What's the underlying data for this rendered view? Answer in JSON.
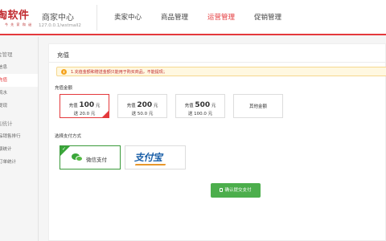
{
  "header": {
    "logo_text": "淘软件",
    "logo_tagline": "今 先 家 和 谜",
    "title": "商家中心",
    "url": "127.0.0.1/wstmall2",
    "nav": [
      {
        "label": "卖家中心",
        "active": false
      },
      {
        "label": "商品管理",
        "active": false
      },
      {
        "label": "运营管理",
        "active": true
      },
      {
        "label": "促销管理",
        "active": false
      }
    ]
  },
  "sidebar": {
    "group1": "金管理",
    "items1": [
      {
        "label": "信息",
        "active": false
      },
      {
        "label": "充值",
        "active": true
      },
      {
        "label": "流水",
        "active": false
      },
      {
        "label": "提现",
        "active": false
      }
    ],
    "group2": "售统计",
    "items2": [
      {
        "label": "品销售排行",
        "active": false
      },
      {
        "label": "额统计",
        "active": false
      },
      {
        "label": "订单统计",
        "active": false
      }
    ]
  },
  "main": {
    "title": "充值",
    "notice": "1.充值金额和赠送金额只能用于购买商品，不能提现；",
    "amount_label": "充值金额",
    "amounts": [
      {
        "prefix": "充值",
        "value": "100",
        "unit": "元",
        "bonus": "送 20.0 元",
        "selected": true
      },
      {
        "prefix": "充值",
        "value": "200",
        "unit": "元",
        "bonus": "送 50.0 元",
        "selected": false
      },
      {
        "prefix": "充值",
        "value": "500",
        "unit": "元",
        "bonus": "送 100.0 元",
        "selected": false
      }
    ],
    "other_amount": "其他金额",
    "payment_label": "选择支付方式",
    "payments": {
      "wechat": "微信支付",
      "alipay": "支付宝"
    },
    "submit": "确认提交支付"
  },
  "colors": {
    "accent": "#e4393c",
    "success": "#4cae4c",
    "notice_bg": "#fff8e1"
  }
}
